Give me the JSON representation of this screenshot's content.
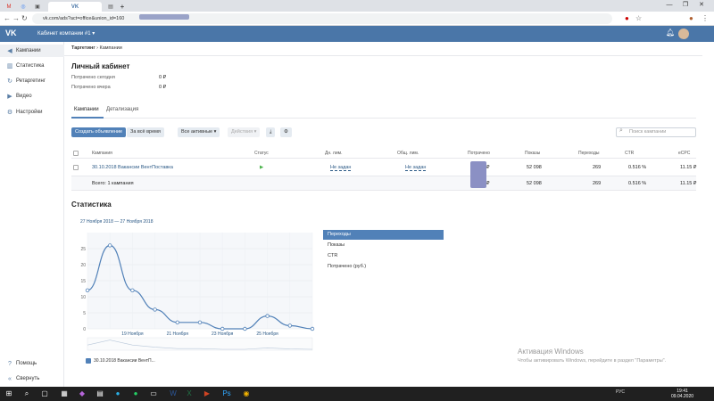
{
  "browser": {
    "tabs": [
      {
        "icon": "gmail-icon",
        "label": "M"
      },
      {
        "icon": "globe-icon",
        "label": "◎"
      },
      {
        "icon": "photo-icon",
        "label": "▣"
      },
      {
        "icon": "vk-icon",
        "label": "VK"
      },
      {
        "icon": "doc-icon",
        "label": "▤"
      }
    ],
    "new_tab_label": "+",
    "url": "vk.com/ads?act=office&union_id=160",
    "window_buttons": {
      "minimize": "—",
      "maximize": "❐",
      "close": "✕"
    }
  },
  "vk": {
    "logo": "VK",
    "cabinet_title": "Кабинет компании #1 ▾",
    "accent": "#4a76a8"
  },
  "sidebar": {
    "items": [
      {
        "icon": "megaphone-icon",
        "glyph": "◀",
        "label": "Кампании"
      },
      {
        "icon": "stats-icon",
        "glyph": "▥",
        "label": "Статистика"
      },
      {
        "icon": "retarget-icon",
        "glyph": "↻",
        "label": "Ретаргетинг"
      },
      {
        "icon": "video-icon",
        "glyph": "▶",
        "label": "Видео"
      },
      {
        "icon": "gear-icon",
        "glyph": "⚙",
        "label": "Настройки"
      }
    ],
    "bottom": [
      {
        "icon": "help-icon",
        "glyph": "?",
        "label": "Помощь"
      },
      {
        "icon": "collapse-icon",
        "glyph": "«",
        "label": "Свернуть"
      }
    ]
  },
  "main": {
    "breadcrumb": {
      "root": "Таргетинг",
      "sep": "›",
      "current": "Кампании"
    },
    "title": "Личный кабинет",
    "spent_today_label": "Потрачено сегодня",
    "spent_today_value": "0 ₽",
    "spent_yesterday_label": "Потрачено вчера",
    "spent_yesterday_value": "0 ₽",
    "tabs": [
      "Кампании",
      "Детализация"
    ],
    "toolbar": {
      "create": "Создать объявление",
      "period": "За всё время",
      "filter": "Все активные ▾",
      "actions": "Действия ▾",
      "download_glyph": "⤓",
      "settings_glyph": "⚙"
    },
    "search_placeholder": "Поиск кампании",
    "table": {
      "headers": [
        "Кампания",
        "Статус",
        "Дн. лим.",
        "Общ. лим.",
        "Потрачено",
        "Показы",
        "Переходы",
        "CTR",
        "eCPC"
      ],
      "rows": [
        {
          "name": "30.10.2018 Вакансии ВентПоставка",
          "status": "▶",
          "day_limit": "Не задан",
          "total_limit": "Не задан",
          "spent": "₽",
          "impressions": "52 098",
          "clicks": "269",
          "ctr": "0.516 %",
          "ecpc": "11.15 ₽"
        }
      ],
      "total": {
        "label": "Всего: 1 кампания",
        "spent": "₽",
        "impressions": "52 098",
        "clicks": "269",
        "ctr": "0.516 %",
        "ecpc": "11.15 ₽"
      }
    }
  },
  "statistics": {
    "title": "Статистика",
    "date_range": "27 Ноября 2018 — 27 Ноября 2018",
    "metrics": [
      "Переходы",
      "Показы",
      "CTR",
      "Потрачено (руб.)"
    ],
    "legend": "30.10.2018 Вакансии ВентП..."
  },
  "chart_data": {
    "type": "line",
    "x": [
      "17",
      "18",
      "19",
      "20",
      "21",
      "22",
      "23",
      "24",
      "25",
      "26",
      "27"
    ],
    "series": [
      {
        "values": [
          12,
          26,
          12,
          6,
          2,
          2,
          0,
          0,
          4,
          1,
          0
        ]
      }
    ],
    "x_tick_labels": [
      "19 Ноября",
      "21 Ноября",
      "23 Ноября",
      "25 Ноября"
    ],
    "y_tick_labels": [
      "0",
      "5",
      "10",
      "15",
      "20",
      "25"
    ],
    "ylim": [
      0,
      30
    ],
    "grid": true,
    "color": "#5181b8"
  },
  "windows_watermark": {
    "line1": "Активация Windows",
    "line2": "Чтобы активировать Windows, перейдите в раздел \"Параметры\"."
  },
  "taskbar": {
    "tray": "РУС",
    "time": "19:41",
    "date": "09.04.2020"
  }
}
